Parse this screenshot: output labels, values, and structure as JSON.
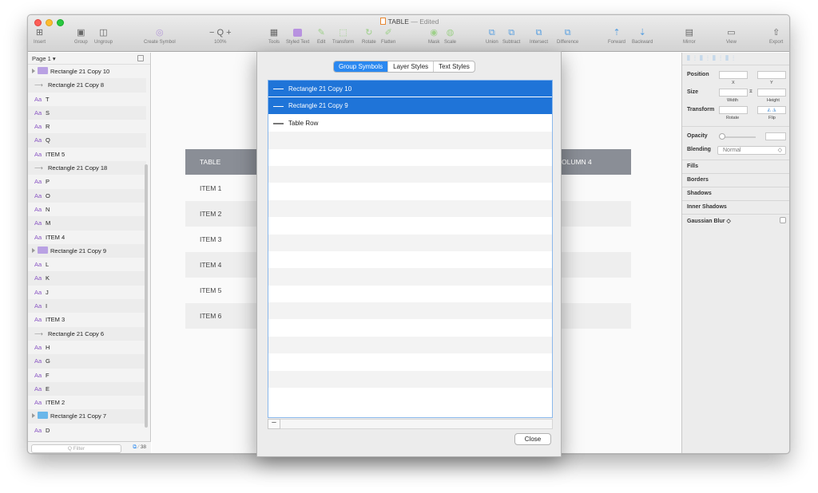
{
  "window": {
    "title": "TABLE",
    "edited_suffix": "— Edited"
  },
  "toolbar": {
    "insert": "Insert",
    "group": "Group",
    "ungroup": "Ungroup",
    "create_symbol": "Create Symbol",
    "zoom_glyph": "− Q +",
    "zoom_level": "100%",
    "tools": "Tools",
    "styled_text": "Styled Text",
    "edit": "Edit",
    "transform": "Transform",
    "rotate": "Rotate",
    "flatten": "Flatten",
    "mask": "Mask",
    "scale": "Scale",
    "union": "Union",
    "subtract": "Subtract",
    "intersect": "Intersect",
    "difference": "Difference",
    "forward": "Forward",
    "backward": "Backward",
    "mirror": "Mirror",
    "view": "View",
    "export": "Export"
  },
  "left_panel": {
    "page_label": "Page 1 ▾",
    "layers": [
      {
        "type": "group",
        "label": "Rectangle 21 Copy 10"
      },
      {
        "type": "symbol",
        "label": "Rectangle 21 Copy 8"
      },
      {
        "type": "text",
        "label": "T"
      },
      {
        "type": "text",
        "label": "S"
      },
      {
        "type": "text",
        "label": "R"
      },
      {
        "type": "text",
        "label": "Q"
      },
      {
        "type": "text",
        "label": "ITEM 5"
      },
      {
        "type": "symbol",
        "label": "Rectangle 21 Copy 18"
      },
      {
        "type": "text",
        "label": "P"
      },
      {
        "type": "text",
        "label": "O"
      },
      {
        "type": "text",
        "label": "N"
      },
      {
        "type": "text",
        "label": "M"
      },
      {
        "type": "text",
        "label": "ITEM 4"
      },
      {
        "type": "group",
        "label": "Rectangle 21 Copy 9"
      },
      {
        "type": "text",
        "label": "L"
      },
      {
        "type": "text",
        "label": "K"
      },
      {
        "type": "text",
        "label": "J"
      },
      {
        "type": "text",
        "label": "I"
      },
      {
        "type": "text",
        "label": "ITEM 3"
      },
      {
        "type": "symbol",
        "label": "Rectangle 21 Copy 6"
      },
      {
        "type": "text",
        "label": "H"
      },
      {
        "type": "text",
        "label": "G"
      },
      {
        "type": "text",
        "label": "F"
      },
      {
        "type": "text",
        "label": "E"
      },
      {
        "type": "text",
        "label": "ITEM 2"
      },
      {
        "type": "group-blue",
        "label": "Rectangle 21 Copy 7"
      },
      {
        "type": "text",
        "label": "D"
      }
    ],
    "filter_placeholder": "Q  Filter",
    "filter_count": "38"
  },
  "canvas": {
    "header_col1": "TABLE",
    "header_col4": "OLUMN 4",
    "rows": [
      "ITEM 1",
      "ITEM 2",
      "ITEM 3",
      "ITEM 4",
      "ITEM 5",
      "ITEM 6"
    ]
  },
  "inspector": {
    "position": "Position",
    "x": "X",
    "y": "Y",
    "size": "Size",
    "width": "Width",
    "height": "Height",
    "transform": "Transform",
    "rotate": "Rotate",
    "flip": "Flip",
    "opacity": "Opacity",
    "blending": "Blending",
    "blending_value": "Normal",
    "fills": "Fills",
    "borders": "Borders",
    "shadows": "Shadows",
    "inner_shadows": "Inner Shadows",
    "gaussian_blur": "Gaussian Blur ◇"
  },
  "dialog": {
    "tabs": [
      "Group Symbols",
      "Layer Styles",
      "Text Styles"
    ],
    "items": [
      {
        "label": "Rectangle 21 Copy 10",
        "selected": true
      },
      {
        "label": "Rectangle 21 Copy 9",
        "selected": true
      },
      {
        "label": "Table Row",
        "selected": false
      }
    ],
    "empty_rows": 16,
    "minus_glyph": "−",
    "close_label": "Close"
  },
  "colors": {
    "accent": "#1f74d8",
    "segment_active": "#2a88f0",
    "table_header": "#8a8e96",
    "close_light": "#fd5e57",
    "minimize_light": "#fdbc2e",
    "zoom_light": "#29c841"
  }
}
